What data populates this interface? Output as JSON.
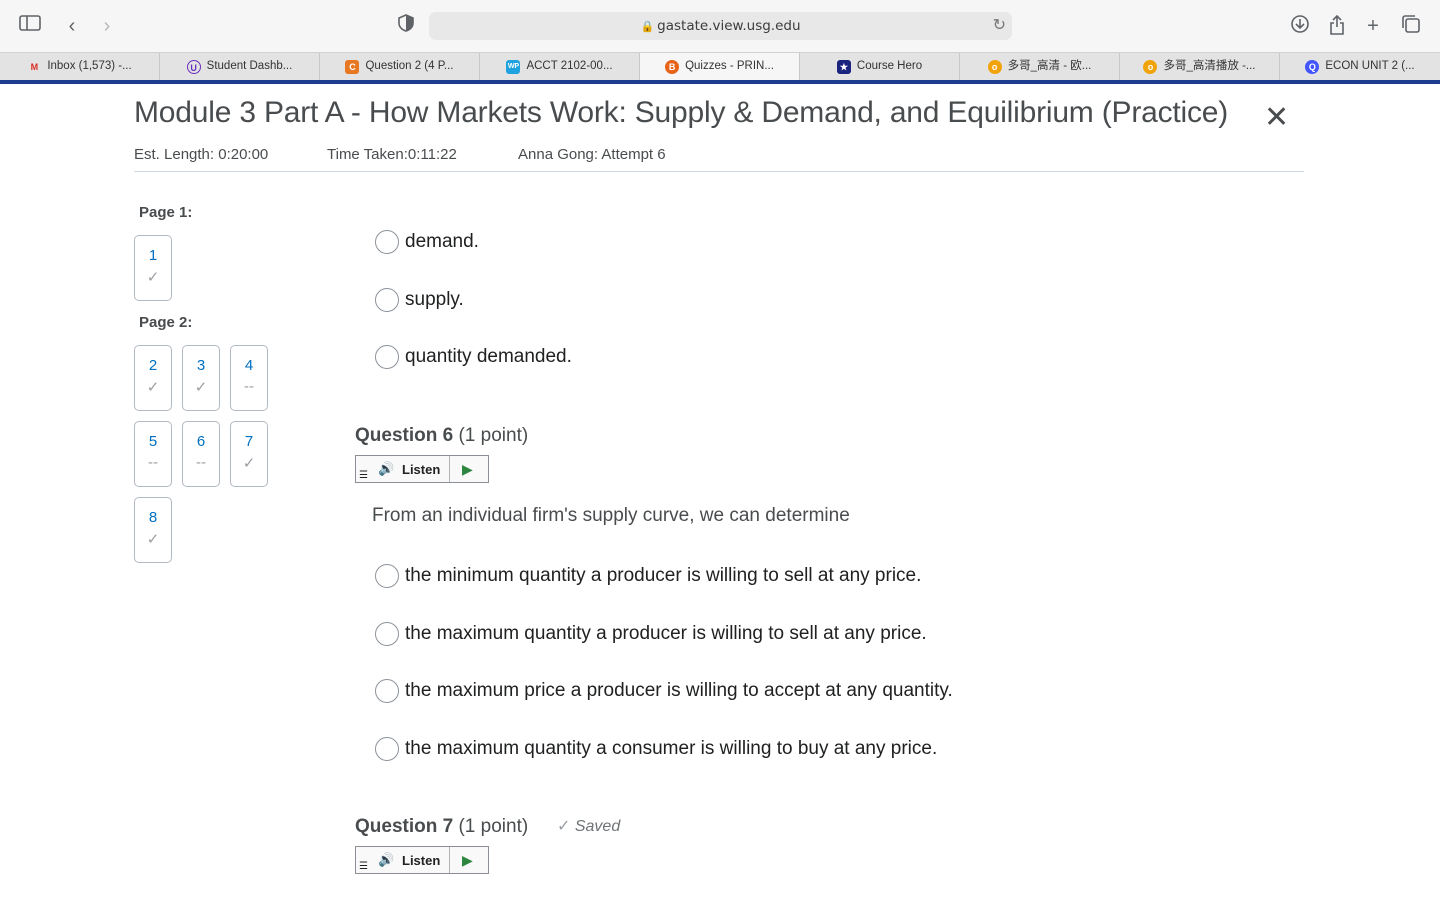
{
  "browser": {
    "url": "gastate.view.usg.edu",
    "tabs": [
      {
        "label": "Inbox (1,573) -...",
        "icon": "gmail-icon",
        "color": "#d93025",
        "glyph": "M",
        "active": false
      },
      {
        "label": "Student Dashb...",
        "icon": "student-dashboard-icon",
        "color": "#6b2fbf",
        "glyph": "U",
        "active": false
      },
      {
        "label": "Question 2 (4 P...",
        "icon": "chegg-icon",
        "color": "#e87722",
        "glyph": "C",
        "active": false
      },
      {
        "label": "ACCT 2102-00...",
        "icon": "wp-icon",
        "color": "#1fa2e0",
        "glyph": "WP",
        "active": false
      },
      {
        "label": "Quizzes - PRIN...",
        "icon": "d2l-icon",
        "color": "#e8631a",
        "glyph": "B",
        "active": true
      },
      {
        "label": "Course Hero",
        "icon": "course-hero-icon",
        "color": "#1a237e",
        "glyph": "★",
        "active": false
      },
      {
        "label": "多哥_高清 - 欧...",
        "icon": "video-site-icon",
        "color": "#f0a30a",
        "glyph": "o",
        "active": false
      },
      {
        "label": "多哥_高清播放 -...",
        "icon": "video-site-icon",
        "color": "#f0a30a",
        "glyph": "o",
        "active": false
      },
      {
        "label": "ECON UNIT 2 (...",
        "icon": "quizlet-icon",
        "color": "#4255ff",
        "glyph": "Q",
        "active": false
      }
    ]
  },
  "quiz": {
    "title": "Module 3 Part A - How Markets Work: Supply & Demand, and Equilibrium (Practice)",
    "est_length": "Est. Length: 0:20:00",
    "time_taken": "Time Taken:0:11:22",
    "attempt": "Anna Gong: Attempt 6"
  },
  "nav": {
    "page1_label": "Page 1:",
    "page2_label": "Page 2:",
    "questions": [
      {
        "num": "1",
        "status": "✓"
      },
      {
        "num": "2",
        "status": "✓"
      },
      {
        "num": "3",
        "status": "✓"
      },
      {
        "num": "4",
        "status": "--"
      },
      {
        "num": "5",
        "status": "--"
      },
      {
        "num": "6",
        "status": "--"
      },
      {
        "num": "7",
        "status": "✓"
      },
      {
        "num": "8",
        "status": "✓"
      }
    ]
  },
  "q5_options": [
    "demand.",
    "supply.",
    "quantity demanded."
  ],
  "q6": {
    "label": "Question 6",
    "points": "(1 point)",
    "listen": "Listen",
    "stem": "From an individual firm's supply curve, we can determine",
    "options": [
      "the minimum quantity a producer is willing to sell at any price.",
      "the maximum quantity a producer is willing to sell at any price.",
      "the maximum price a producer is willing to accept at any quantity.",
      "the maximum quantity a consumer is willing to buy at any price."
    ]
  },
  "q7": {
    "label": "Question 7",
    "points": "(1 point)",
    "saved": "Saved",
    "listen": "Listen"
  }
}
